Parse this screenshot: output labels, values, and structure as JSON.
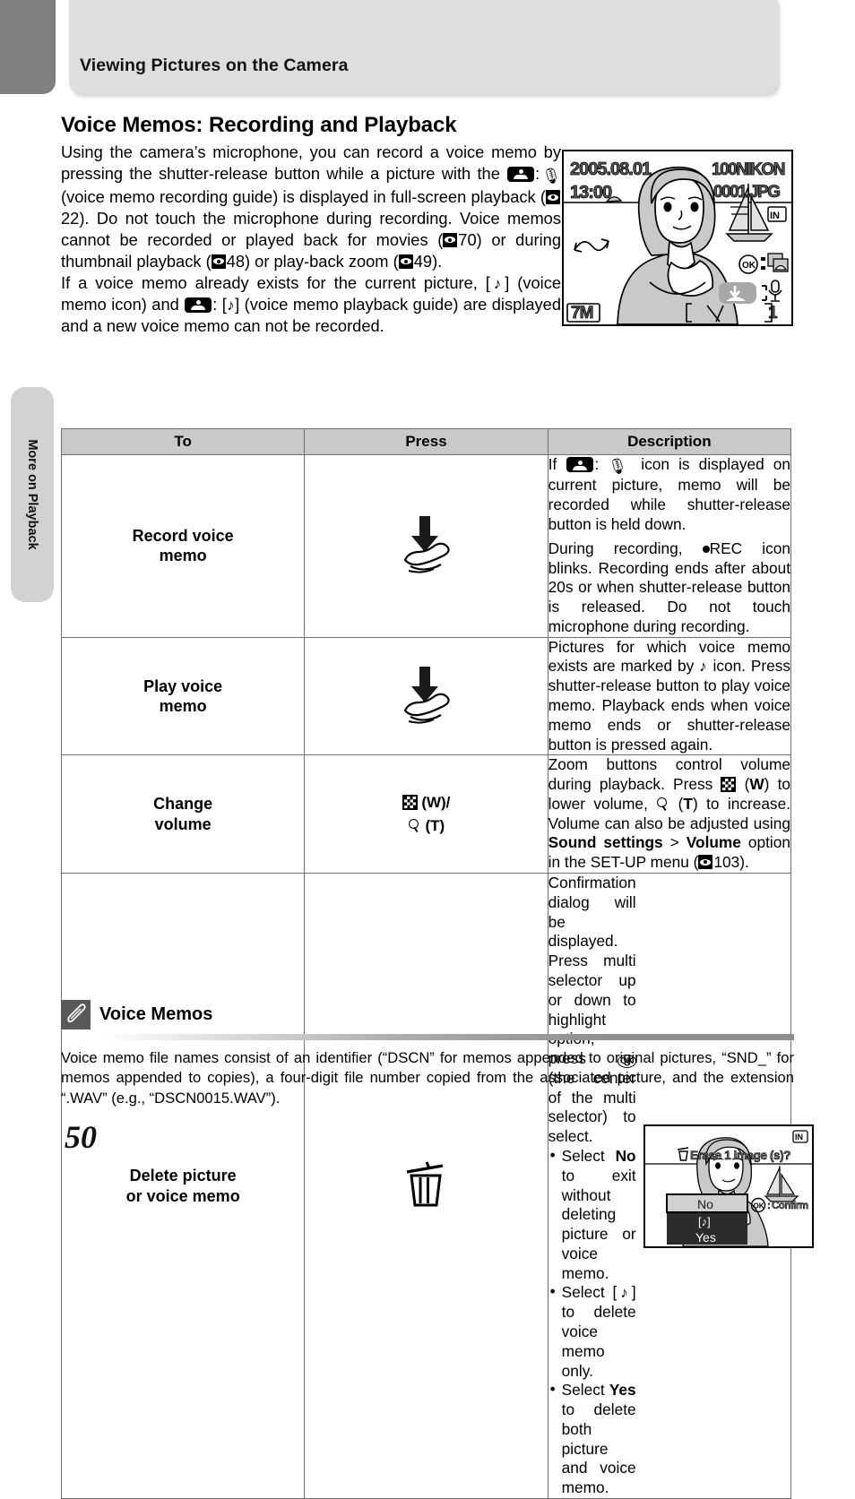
{
  "page": {
    "number": "50",
    "side_tab": "More on Playback",
    "header_title": "Viewing Pictures on the Camera"
  },
  "section": {
    "title": "Voice Memos: Recording and Playback",
    "paragraph1_part1": "Using the camera’s microphone, you can record a voice memo by pressing the shutter-release button while a picture with the ",
    "paragraph1_mic_label": ":",
    "paragraph1_part2": " (voice memo recording guide) is displayed in full-screen playback (",
    "ref_22": "22",
    "paragraph1_part3": "). Do not touch the microphone during recording. Voice memos cannot be recorded or played back for movies (",
    "ref_70": "70",
    "paragraph1_part4": ") or during thumbnail playback (",
    "ref_48": "48",
    "paragraph1_part5": ") or play-back zoom (",
    "ref_49": "49",
    "paragraph1_part6": ").",
    "paragraph2_part1": "If a voice memo already exists for the current picture, [",
    "paragraph2_part2": "] (voice memo icon) and ",
    "paragraph2_part3": ": [",
    "paragraph2_part4": "] (voice memo playback guide) are displayed and a new voice memo can not be recorded.",
    "note_icon": "musical-note"
  },
  "camera_screen": {
    "date": "2005.08.01",
    "time": "13:00",
    "folder": "100NIKON",
    "file": "0001.JPG",
    "memory_badge": "IN",
    "image_size": "7M",
    "frame_number": "1",
    "ok_badge": "OK",
    "guide_icon": "voice-memo-record-guide",
    "mic_icon": "microphone"
  },
  "table": {
    "headers": [
      "To",
      "Press",
      "Description"
    ],
    "rows": [
      {
        "to": "Record voice\nmemo",
        "to_line1": "Record voice",
        "to_line2": "memo",
        "press_icon": "shutter-release-press",
        "desc_p1_a": "If ",
        "desc_p1_b": ": ",
        "desc_p1_c": " icon is displayed on current picture, memo will be recorded while shutter-release button is held down.",
        "desc_p2_a": "During recording, ",
        "desc_p2_rec": "REC",
        "desc_p2_b": " icon blinks. Recording ends after about 20s or when shutter-release button is released. Do not touch microphone during recording."
      },
      {
        "to_line1": "Play voice",
        "to_line2": "memo",
        "press_icon": "shutter-release-press",
        "desc_a": "Pictures for which voice memo exists are marked by ",
        "desc_b": " icon. Press shutter-release button to play voice memo. Playback ends when voice memo ends or shutter-release button is pressed again."
      },
      {
        "to_line1": "Change",
        "to_line2": "volume",
        "press_wide": "(W)/",
        "press_tele": "(T)",
        "desc_a": "Zoom buttons control volume during playback. Press ",
        "desc_b": " (",
        "desc_w": "W",
        "desc_c": ") to lower volume, ",
        "desc_t": "T",
        "desc_d": ") to increase. Volume can also be adjusted using ",
        "desc_sound": "Sound settings",
        "desc_gt": " > ",
        "desc_volume": "Volume",
        "desc_e": " option in the SET-UP menu (",
        "ref_103": "103",
        "desc_f": ")."
      },
      {
        "to_line1": "Delete picture",
        "to_line2": "or voice memo",
        "press_icon": "trash-can",
        "desc_p1_a": "Confirmation dialog will be displayed. Press multi selector up or down to highlight option, press ",
        "desc_ok": "OK",
        "desc_p1_b": " (the center of the multi selector) to select.",
        "bullets": [
          {
            "a": "Select ",
            "bold": "No",
            "b": " to exit without deleting picture or voice memo."
          },
          {
            "a": "Select [",
            "bold": "♪",
            "b": "] to delete voice memo only."
          },
          {
            "a": "Select ",
            "bold": "Yes",
            "b": " to delete both picture and voice memo."
          }
        ],
        "dialog": {
          "message": "Erase 1 image (s)?",
          "option_no": "No",
          "option_memo": "[♪]",
          "option_yes": "Yes",
          "confirm_hint": "Confirm",
          "ok_badge": "OK",
          "memory_badge": "IN"
        }
      }
    ]
  },
  "note": {
    "icon": "pencil-icon",
    "title": "Voice Memos",
    "body": "Voice memo file names consist of an identifier (“DSCN” for memos appended to original pictures, “SND_” for memos appended to copies), a four-digit file number copied from the associated picture, and the extension “.WAV” (e.g., “DSCN0015.WAV”)."
  },
  "colors": {
    "header_panel": "#dededf",
    "corner_tab": "#808080",
    "side_tab": "#d2d2d2",
    "table_header": "#c9c9c9",
    "table_border": "#6f6f6f",
    "note_icon_bg": "#595959"
  }
}
